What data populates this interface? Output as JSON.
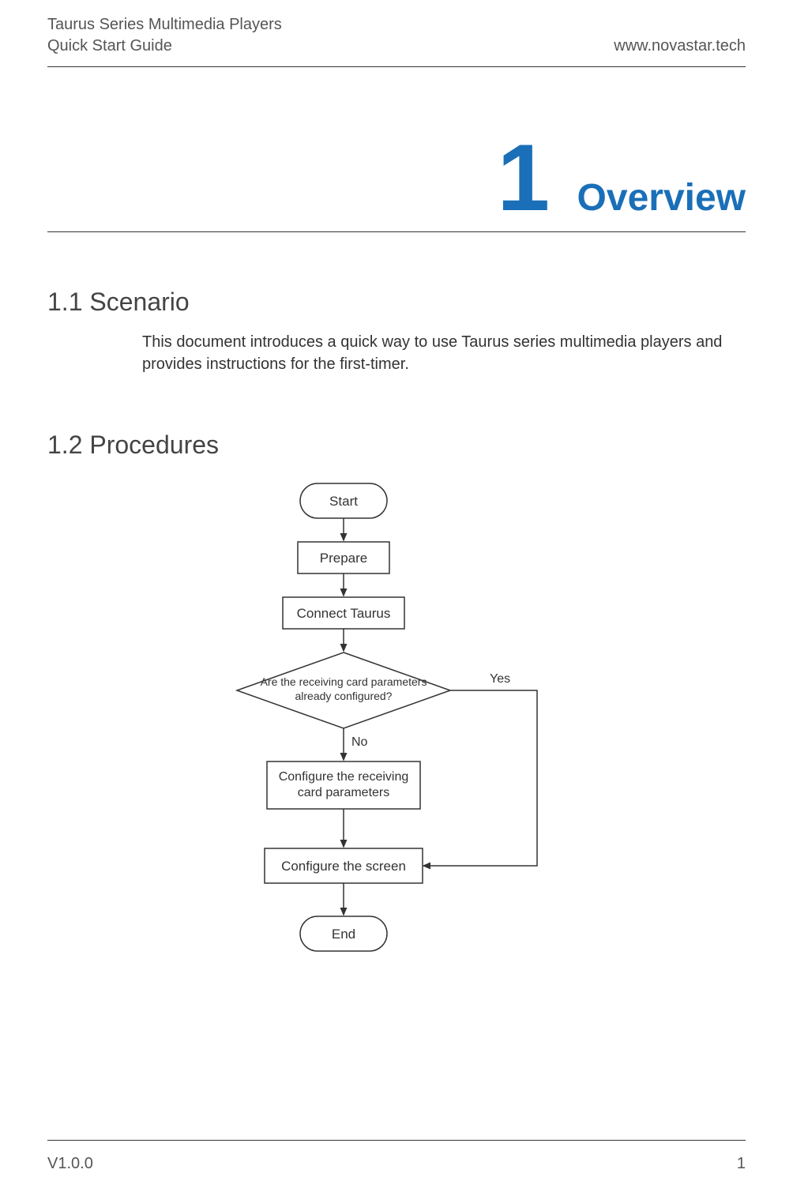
{
  "header": {
    "title_line1": "Taurus Series Multimedia Players",
    "title_line2": "Quick Start Guide",
    "site": "www.novastar.tech"
  },
  "chapter": {
    "number": "1",
    "title": "Overview"
  },
  "sections": {
    "s1": {
      "heading": "1.1  Scenario",
      "body": "This document introduces a quick way to use Taurus series multimedia players and provides instructions for the first-timer."
    },
    "s2": {
      "heading": "1.2  Procedures"
    }
  },
  "flowchart": {
    "start": "Start",
    "prepare": "Prepare",
    "connect": "Connect Taurus",
    "decision_line1": "Are the receiving card parameters",
    "decision_line2": "already configured?",
    "yes": "Yes",
    "no": "No",
    "configure_recv_line1": "Configure the receiving",
    "configure_recv_line2": "card parameters",
    "configure_screen": "Configure the screen",
    "end": "End"
  },
  "footer": {
    "version": "V1.0.0",
    "page": "1"
  }
}
